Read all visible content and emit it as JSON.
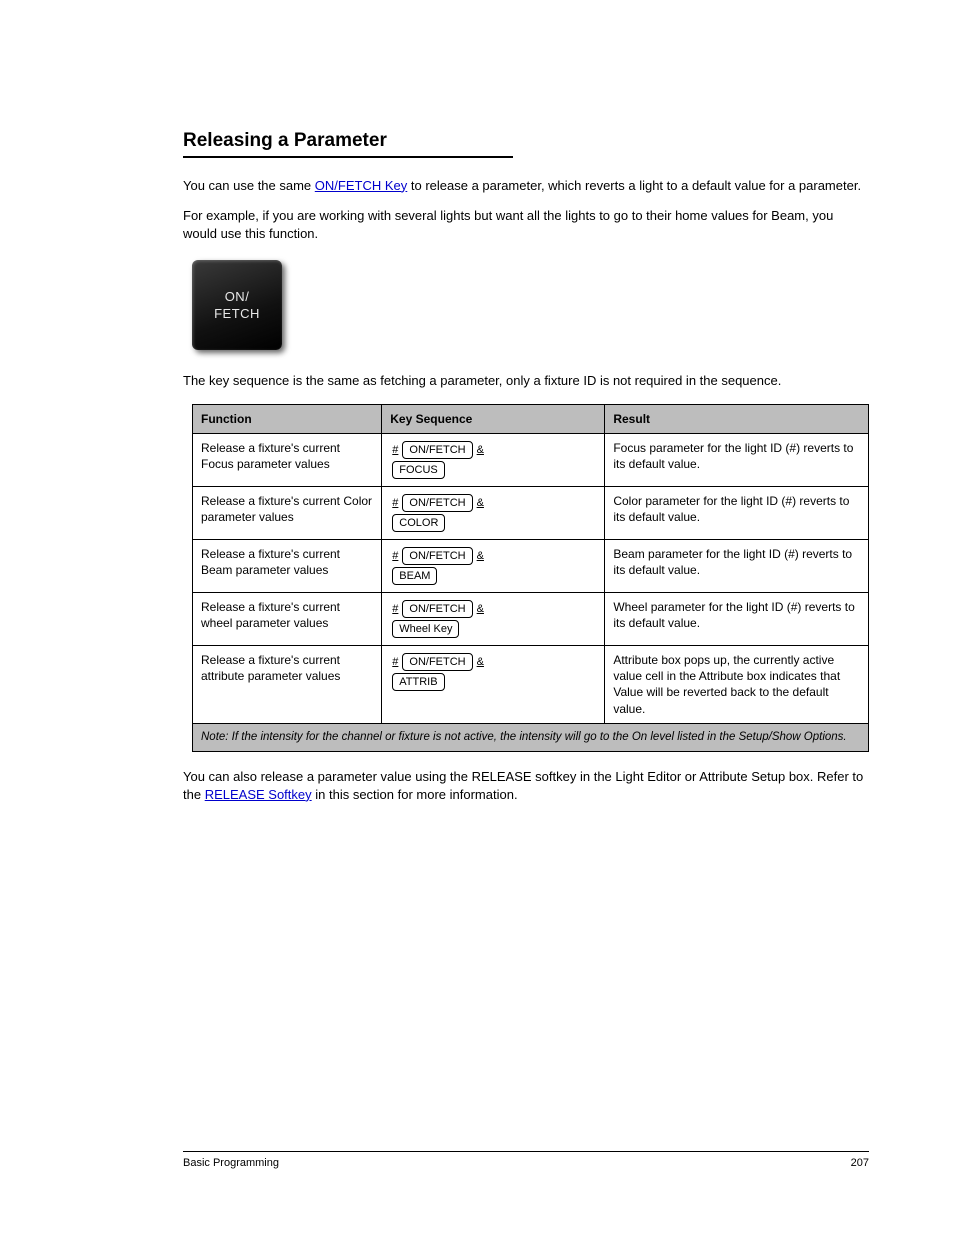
{
  "header": {
    "section_title": "Releasing a Parameter"
  },
  "intro": {
    "para1_a": "You can use the same ",
    "para1_link": "ON/FETCH Key",
    "para1_b": " to release a parameter, which reverts a light to a default value for a parameter.",
    "para2": "For example, if you are working with several lights but want all the lights to go to their home values for Beam, you would use this function.",
    "para3": "The key sequence is the same as fetching a parameter, only a fixture ID is not required in the sequence."
  },
  "key_illustration": "ON/\nFETCH",
  "table": {
    "headers": [
      "Function",
      "Key Sequence",
      "Result"
    ],
    "rows": [
      {
        "func": "Release a fixture's current Focus parameter values",
        "keys": [
          {
            "type": "underline",
            "text": "#"
          },
          {
            "type": "cap",
            "text": "ON/FETCH"
          },
          {
            "type": "underline",
            "text": "&"
          },
          {
            "type": "br"
          },
          {
            "type": "cap",
            "text": "FOCUS"
          }
        ],
        "result": "Focus parameter for the light ID (#) reverts to its default value."
      },
      {
        "func": "Release a fixture's current Color parameter values",
        "keys": [
          {
            "type": "underline",
            "text": "#"
          },
          {
            "type": "cap",
            "text": "ON/FETCH"
          },
          {
            "type": "underline",
            "text": "&"
          },
          {
            "type": "br"
          },
          {
            "type": "cap",
            "text": "COLOR"
          }
        ],
        "result": "Color parameter for the light ID (#) reverts to its default value."
      },
      {
        "func": "Release a fixture's current Beam parameter values",
        "keys": [
          {
            "type": "underline",
            "text": "#"
          },
          {
            "type": "cap",
            "text": "ON/FETCH"
          },
          {
            "type": "underline",
            "text": "&"
          },
          {
            "type": "br"
          },
          {
            "type": "cap",
            "text": "BEAM"
          }
        ],
        "result": "Beam parameter for the light ID (#) reverts to its default value."
      },
      {
        "func": "Release a fixture's current wheel parameter values",
        "keys": [
          {
            "type": "underline",
            "text": "#"
          },
          {
            "type": "cap",
            "text": "ON/FETCH"
          },
          {
            "type": "underline",
            "text": "&"
          },
          {
            "type": "br"
          },
          {
            "type": "cap",
            "text": "Wheel Key"
          }
        ],
        "result": "Wheel parameter for the light ID (#) reverts to its default value."
      },
      {
        "func": "Release a fixture's current attribute parameter values",
        "keys": [
          {
            "type": "underline",
            "text": "#"
          },
          {
            "type": "cap",
            "text": "ON/FETCH"
          },
          {
            "type": "underline",
            "text": "&"
          },
          {
            "type": "br"
          },
          {
            "type": "cap",
            "text": "ATTRIB"
          }
        ],
        "result": "Attribute box pops up, the currently active value cell in the Attribute box indicates that Value will be reverted back to the default value."
      }
    ],
    "note": "Note: If the intensity for the channel or fixture is not active, the intensity will go to the On level listed in the Setup/Show Options."
  },
  "post_text": {
    "a": "You can also release a parameter value using the RELEASE softkey in the Light Editor or Attribute Setup box. Refer to the ",
    "link": "RELEASE Softkey",
    "b": " in this section for more information."
  },
  "footer": {
    "left": "Basic Programming",
    "right": "207"
  }
}
